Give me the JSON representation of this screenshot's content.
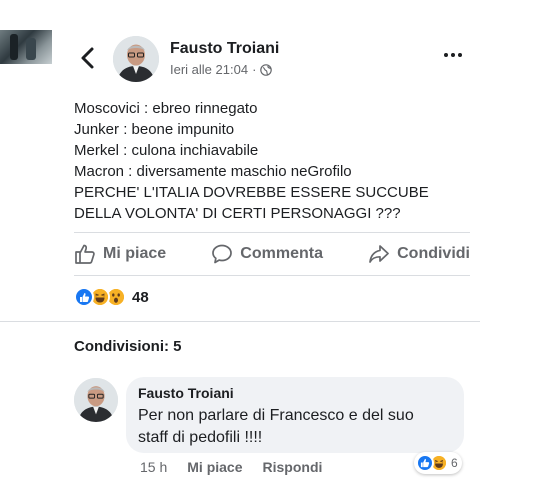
{
  "post": {
    "author": "Fausto Troiani",
    "timestamp": "Ieri alle 21:04",
    "visibility_icon": "globe-icon",
    "lines": [
      "Moscovici : ebreo rinnegato",
      "Junker : beone impunito",
      "Merkel : culona inchiavabile",
      "Macron : diversamente maschio neGrofilo",
      "PERCHE' L'ITALIA DOVREBBE ESSERE SUCCUBE",
      "DELLA VOLONTA' DI CERTI PERSONAGGI ???"
    ]
  },
  "actions": {
    "like": "Mi piace",
    "comment": "Commenta",
    "share": "Condividi"
  },
  "reactions": {
    "icons": [
      "like-icon",
      "haha-icon",
      "wow-icon"
    ],
    "count": "48"
  },
  "shares": "Condivisioni: 5",
  "comment": {
    "author": "Fausto Troiani",
    "lines": [
      "Per non parlare di Francesco e del suo",
      "staff di pedofili !!!!"
    ],
    "time": "15 h",
    "like": "Mi piace",
    "reply": "Rispondi",
    "reactions_icons": [
      "like-icon",
      "haha-icon"
    ],
    "reaction_count": "6"
  },
  "colors": {
    "like_blue": "#1877f2",
    "emoji_yellow": "#f7b125",
    "secondary_text": "#65676b",
    "bubble_bg": "#f0f2f5"
  }
}
